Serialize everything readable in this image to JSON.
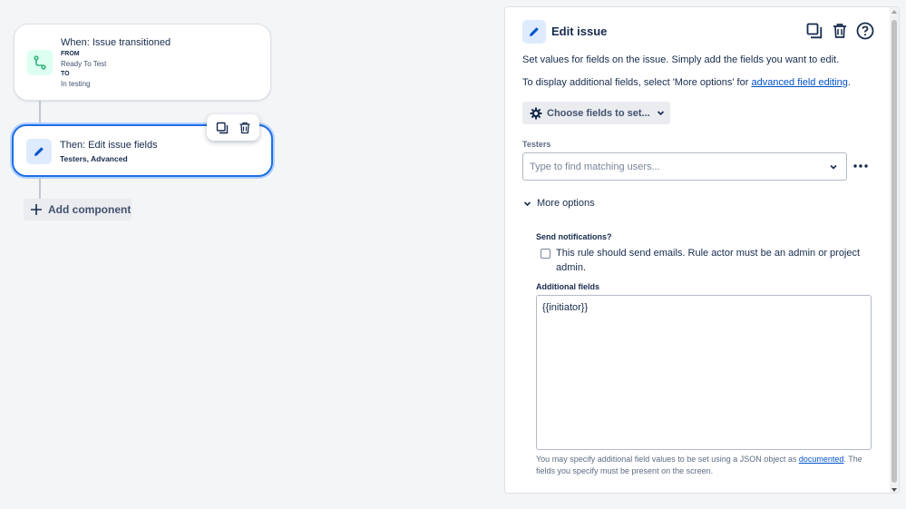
{
  "trigger": {
    "title": "When: Issue transitioned",
    "from_label": "FROM",
    "from_value": "Ready To Test",
    "to_label": "TO",
    "to_value": "In testing",
    "icon": "transition-icon",
    "icon_color": "#36b37e"
  },
  "action": {
    "title": "Then: Edit issue fields",
    "subtitle": "Testers, Advanced",
    "icon": "pencil-icon",
    "icon_color": "#0052cc",
    "toolbar": [
      "duplicate-icon",
      "trash-icon"
    ]
  },
  "add_component": {
    "label": "Add component",
    "icon": "plus-icon"
  },
  "panel": {
    "title": "Edit issue",
    "actions": [
      "duplicate-icon",
      "trash-icon",
      "help-icon"
    ],
    "description_1": "Set values for fields on the issue. Simply add the fields you want to edit.",
    "description_2_prefix": "To display additional fields, select 'More options' for ",
    "description_2_link": "advanced field editing",
    "description_2_suffix": ".",
    "choose_fields": {
      "label": "Choose fields to set...",
      "icon": "gear-icon"
    },
    "testers": {
      "label": "Testers",
      "placeholder": "Type to find matching users..."
    },
    "more_options_label": "More options",
    "send_notifications": {
      "label": "Send notifications?",
      "checkbox_text": "This rule should send emails. Rule actor must be an admin or project admin.",
      "checked": false
    },
    "additional_fields": {
      "label": "Additional fields",
      "value": "{{initiator}}"
    },
    "help_prefix": "You may specify additional field values to be set using a JSON object as ",
    "help_link": "documented",
    "help_suffix": ". The fields you specify must be present on the screen."
  },
  "colors": {
    "accent": "#1f6fe5",
    "link": "#0052cc",
    "text": "#172b4d"
  }
}
